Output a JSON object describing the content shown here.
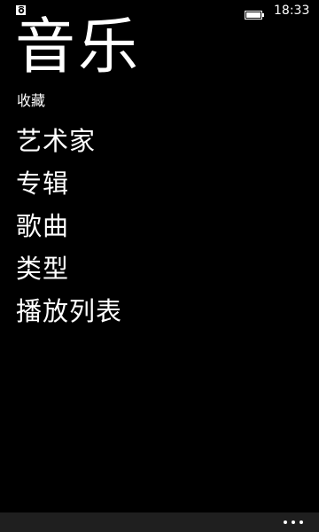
{
  "status_bar": {
    "time": "18:33",
    "battery_icon": "battery-full-icon",
    "app_icon": "music-app-icon"
  },
  "app": {
    "title": "音乐"
  },
  "section": {
    "header": "收藏"
  },
  "menu": {
    "items": [
      {
        "label": "艺术家"
      },
      {
        "label": "专辑"
      },
      {
        "label": "歌曲"
      },
      {
        "label": "类型"
      },
      {
        "label": "播放列表"
      }
    ]
  },
  "app_bar": {
    "more_icon": "more-options-icon"
  },
  "colors": {
    "background": "#000000",
    "foreground": "#ffffff",
    "app_bar": "#1f1f1f"
  }
}
